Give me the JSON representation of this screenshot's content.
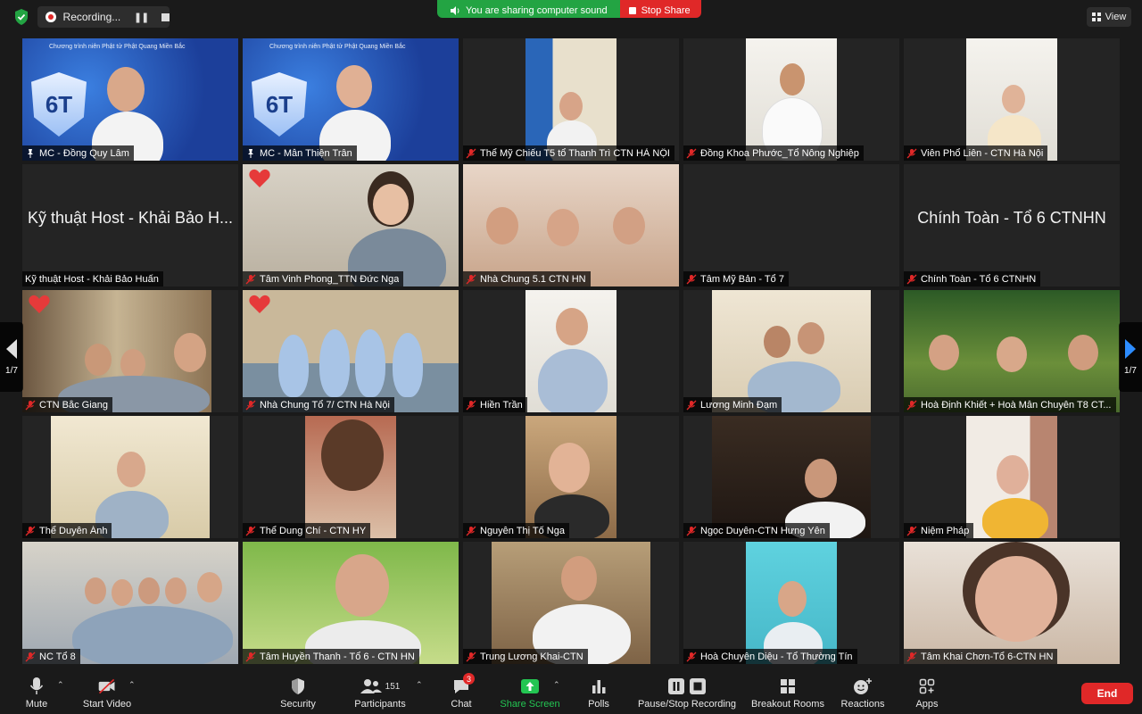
{
  "topbar": {
    "recording_label": "Recording...",
    "share_sound_text": "You are sharing computer sound",
    "stop_share_label": "Stop Share",
    "view_label": "View"
  },
  "colors": {
    "accent_green": "#23a443",
    "danger_red": "#e02828",
    "active_speaker_border": "#e4e17a",
    "pager_blue": "#2d8cff"
  },
  "gallery": {
    "page_indicator_left": "1/7",
    "page_indicator_right": "1/7",
    "branding_text": "Chương trình niên Phật tử Phật Quang Miền Bắc",
    "badge_text": "6T",
    "tiles": [
      {
        "name": "MC - Đồng Quy Lâm",
        "kind": "video",
        "mic": "pinned",
        "active": true
      },
      {
        "name": "MC - Mẫn Thiện Trân",
        "kind": "video",
        "mic": "pinned"
      },
      {
        "name": "Thể Mỹ Chiếu T5 tổ Thanh Trì CTN HÀ NỘI",
        "kind": "video",
        "mic": "muted"
      },
      {
        "name": "Đồng Khoa Phước_Tổ Nông Nghiệp",
        "kind": "video",
        "mic": "muted"
      },
      {
        "name": "Viên Phổ Liên - CTN Hà Nội",
        "kind": "video",
        "mic": "muted"
      },
      {
        "name": "Kỹ thuật Host - Khải Bảo Huấn",
        "kind": "text",
        "display": "Kỹ thuật Host - Khải Bảo H...",
        "mic": "none"
      },
      {
        "name": "Tâm Vinh Phong_TTN Đức Nga",
        "kind": "video",
        "mic": "muted",
        "reaction": "heart"
      },
      {
        "name": "Nhà Chung 5.1 CTN HN",
        "kind": "video",
        "mic": "muted"
      },
      {
        "name": "Tâm Mỹ Bản - Tổ 7",
        "kind": "blank",
        "mic": "muted"
      },
      {
        "name": "Chính Toàn - Tổ 6 CTNHN",
        "kind": "text",
        "display": "Chính Toàn - Tổ 6 CTNHN",
        "mic": "muted"
      },
      {
        "name": "CTN Bắc Giang",
        "kind": "video",
        "mic": "muted",
        "reaction": "heart"
      },
      {
        "name": "Nhà Chung Tổ 7/ CTN Hà Nội",
        "kind": "video",
        "mic": "muted",
        "reaction": "heart"
      },
      {
        "name": "Hiền Trần",
        "kind": "video",
        "mic": "muted"
      },
      {
        "name": "Lương Minh Đạm",
        "kind": "video",
        "mic": "muted"
      },
      {
        "name": "Hoà Định Khiết + Hoà Mẫn Chuyên T8 CT...",
        "kind": "video",
        "mic": "muted"
      },
      {
        "name": "Thể Duyên Ánh",
        "kind": "video",
        "mic": "muted"
      },
      {
        "name": "Thể Dung Chí - CTN HY",
        "kind": "video",
        "mic": "muted"
      },
      {
        "name": "Nguyễn Thị Tố Nga",
        "kind": "video",
        "mic": "muted"
      },
      {
        "name": "Ngọc Duyên-CTN Hưng Yên",
        "kind": "video",
        "mic": "muted"
      },
      {
        "name": "Niệm Pháp",
        "kind": "video",
        "mic": "muted"
      },
      {
        "name": "NC Tổ 8",
        "kind": "video",
        "mic": "muted"
      },
      {
        "name": "Tâm Huyền Thanh - Tổ 6 - CTN HN",
        "kind": "video",
        "mic": "muted"
      },
      {
        "name": "Trung Lương Khai-CTN",
        "kind": "video",
        "mic": "muted"
      },
      {
        "name": "Hoà Chuyên Diệu - Tổ Thường Tín",
        "kind": "video",
        "mic": "muted"
      },
      {
        "name": "Tâm Khai Chơn-Tổ 6-CTN HN",
        "kind": "video",
        "mic": "muted"
      }
    ]
  },
  "toolbar": {
    "mute_label": "Mute",
    "start_video_label": "Start Video",
    "security_label": "Security",
    "participants_label": "Participants",
    "participants_count": "151",
    "chat_label": "Chat",
    "chat_badge": "3",
    "share_screen_label": "Share Screen",
    "polls_label": "Polls",
    "pause_recording_label": "Pause/Stop Recording",
    "breakout_label": "Breakout Rooms",
    "reactions_label": "Reactions",
    "apps_label": "Apps",
    "end_label": "End"
  }
}
